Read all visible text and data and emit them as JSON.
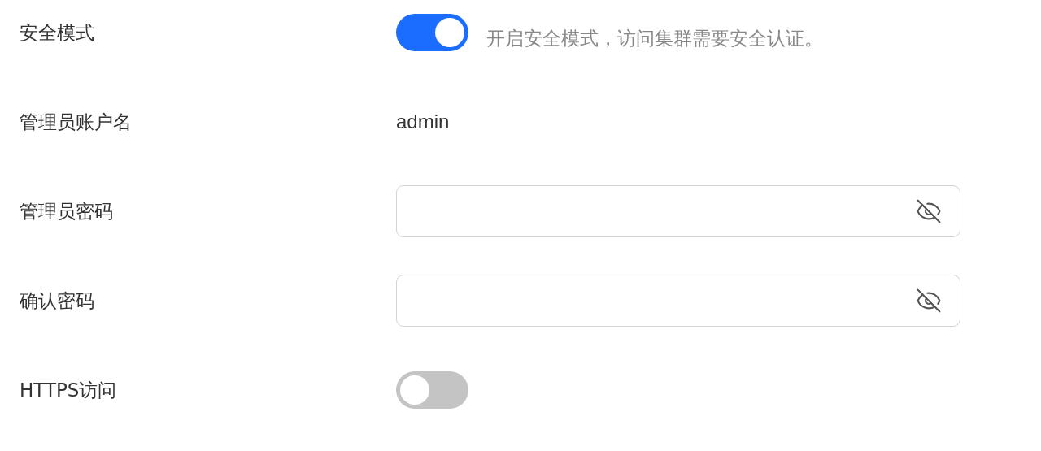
{
  "fields": [
    {
      "kind": "toggle",
      "label": "安全模式",
      "on": true,
      "hint": "开启安全模式，访问集群需要安全认证。"
    },
    {
      "kind": "text",
      "label": "管理员账户名",
      "value": "admin"
    },
    {
      "kind": "password",
      "label": "管理员密码"
    },
    {
      "kind": "password",
      "label": "确认密码"
    },
    {
      "kind": "toggle",
      "label": "HTTPS访问",
      "on": false
    }
  ]
}
